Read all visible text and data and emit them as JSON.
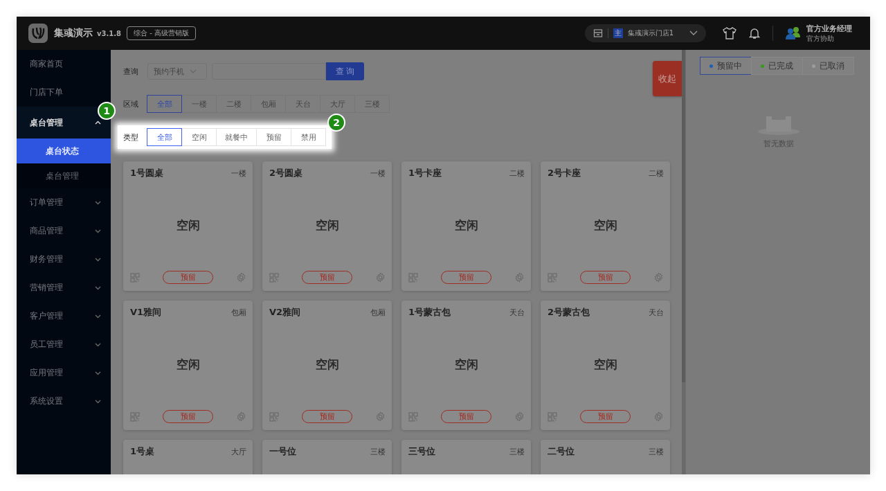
{
  "header": {
    "app_name": "集彧演示",
    "version": "v3.1.8",
    "edition": "综合 - 高级营销版",
    "store": {
      "badge": "主",
      "name": "集彧演示门店1"
    },
    "user": {
      "name": "官方业务经理",
      "role": "官方协助"
    }
  },
  "sidebar": {
    "items": [
      {
        "label": "商家首页",
        "selected": false
      },
      {
        "label": "门店下单",
        "selected": false
      },
      {
        "label": "桌台管理",
        "expanded": true,
        "callout": "1",
        "children": [
          {
            "label": "桌台状态",
            "selected": true
          },
          {
            "label": "桌台管理",
            "selected": false
          }
        ]
      },
      {
        "label": "订单管理",
        "selected": false,
        "expanded": false
      },
      {
        "label": "商品管理",
        "selected": false,
        "expanded": false
      },
      {
        "label": "财务管理",
        "selected": false,
        "expanded": false
      },
      {
        "label": "营销管理",
        "selected": false,
        "expanded": false
      },
      {
        "label": "客户管理",
        "selected": false,
        "expanded": false
      },
      {
        "label": "员工管理",
        "selected": false,
        "expanded": false
      },
      {
        "label": "应用管理",
        "selected": false,
        "expanded": false
      },
      {
        "label": "系统设置",
        "selected": false,
        "expanded": false
      }
    ]
  },
  "search": {
    "label": "查询",
    "field": "预约手机",
    "button": "查 询"
  },
  "filters": [
    {
      "label": "区域",
      "highlighted": false,
      "options": [
        {
          "label": "全部",
          "selected": true
        },
        {
          "label": "一楼",
          "selected": false
        },
        {
          "label": "二楼",
          "selected": false
        },
        {
          "label": "包厢",
          "selected": false
        },
        {
          "label": "天台",
          "selected": false
        },
        {
          "label": "大厅",
          "selected": false
        },
        {
          "label": "三楼",
          "selected": false
        }
      ]
    },
    {
      "label": "类型",
      "highlighted": true,
      "callout": "2",
      "options": [
        {
          "label": "全部",
          "selected": true
        },
        {
          "label": "空闲",
          "selected": false
        },
        {
          "label": "就餐中",
          "selected": false
        },
        {
          "label": "预留",
          "selected": false
        },
        {
          "label": "禁用",
          "selected": false
        }
      ]
    }
  ],
  "collapse_button": "收起",
  "tables": [
    {
      "name": "1号圆桌",
      "area": "一楼",
      "status": "空闲",
      "action": "预留"
    },
    {
      "name": "2号圆桌",
      "area": "一楼",
      "status": "空闲",
      "action": "预留"
    },
    {
      "name": "1号卡座",
      "area": "二楼",
      "status": "空闲",
      "action": "预留"
    },
    {
      "name": "2号卡座",
      "area": "二楼",
      "status": "空闲",
      "action": "预留"
    },
    {
      "name": "V1雅间",
      "area": "包厢",
      "status": "空闲",
      "action": "预留"
    },
    {
      "name": "V2雅间",
      "area": "包厢",
      "status": "空闲",
      "action": "预留"
    },
    {
      "name": "1号蒙古包",
      "area": "天台",
      "status": "空闲",
      "action": "预留"
    },
    {
      "name": "2号蒙古包",
      "area": "天台",
      "status": "空闲",
      "action": "预留"
    },
    {
      "name": "1号桌",
      "area": "大厅"
    },
    {
      "name": "一号位",
      "area": "三楼"
    },
    {
      "name": "三号位",
      "area": "三楼"
    },
    {
      "name": "二号位",
      "area": "三楼"
    }
  ],
  "reservations": {
    "tabs": [
      {
        "label": "预留中",
        "selected": true,
        "color": "#1f5fb0"
      },
      {
        "label": "已完成",
        "selected": false,
        "color": "#3a9a1c"
      },
      {
        "label": "已取消",
        "selected": false,
        "color": "#9c9c9c"
      }
    ],
    "empty_text": "暂无数据"
  }
}
